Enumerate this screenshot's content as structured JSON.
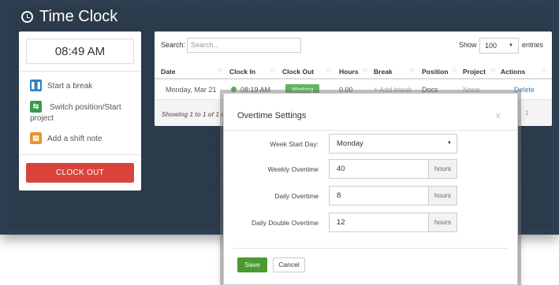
{
  "app": {
    "title": "Time Clock"
  },
  "left_panel": {
    "current_time": "08:49 AM",
    "actions": [
      {
        "label": "Start a break",
        "icon": "pause-icon"
      },
      {
        "label": "Switch position/Start project",
        "icon": "switch-icon"
      },
      {
        "label": "Add a shift note",
        "icon": "note-icon"
      }
    ],
    "clock_out_label": "CLOCK OUT"
  },
  "table": {
    "search_label": "Search:",
    "search_placeholder": "Search...",
    "show_label": "Show",
    "page_size": "100",
    "entries_label": "entries",
    "columns": [
      "Date",
      "Clock In",
      "Clock Out",
      "Hours",
      "Break",
      "Position",
      "Project",
      "Actions"
    ],
    "rows": [
      {
        "date": "Monday, Mar 21",
        "clock_in": "08:19 AM",
        "clock_out": "Working",
        "hours": "0.00",
        "break": "+ Add break",
        "position": "Docs",
        "project": "None",
        "action": "Delete"
      }
    ],
    "showing_text": "Showing 1 to 1 of 1 e",
    "page_number": "1"
  },
  "modal": {
    "title": "Overtime Settings",
    "close": "x",
    "week_start_label": "Week Start Day:",
    "week_start_value": "Monday",
    "weekly_label": "Weekly Overtime",
    "weekly_value": "40",
    "daily_label": "Daily Overtime",
    "daily_value": "8",
    "double_label": "Daily Double Overtime",
    "double_value": "12",
    "unit": "hours",
    "save_label": "Save",
    "cancel_label": "Cancel"
  },
  "colors": {
    "background": "#2d3e50",
    "clock_out": "#d9443a",
    "save": "#4a9a2f",
    "working": "#5cb85c",
    "link": "#2f7fc1"
  }
}
